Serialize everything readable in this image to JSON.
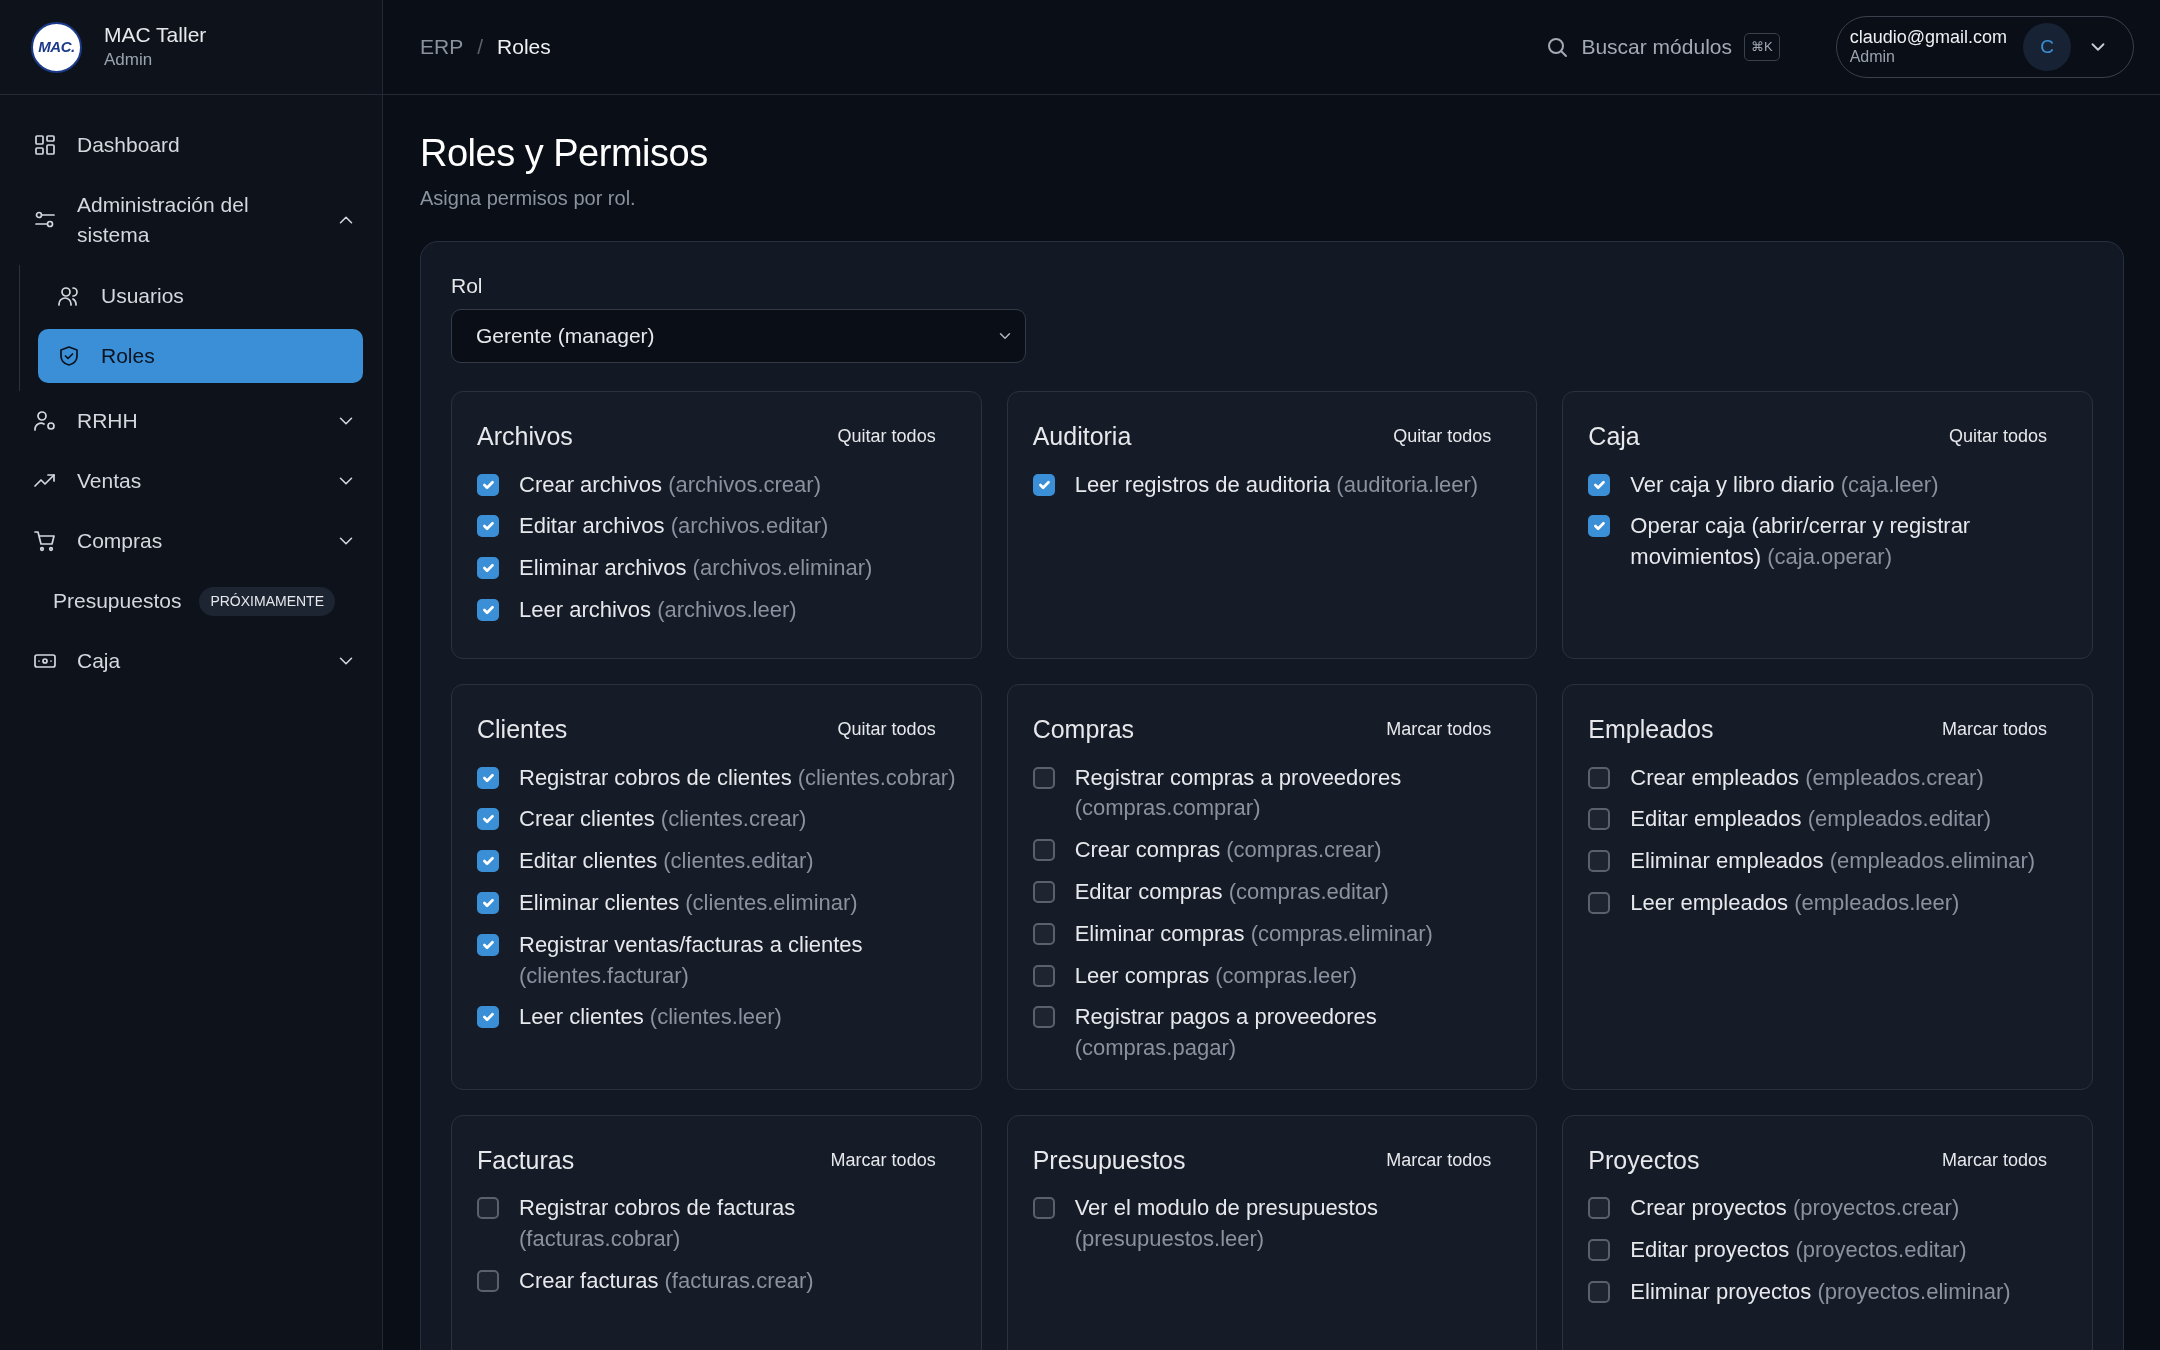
{
  "brand": {
    "logo_text": "MAC.",
    "name": "MAC Taller",
    "role": "Admin"
  },
  "sidebar": {
    "items": [
      {
        "label": "Dashboard",
        "kind": "link",
        "selected": false
      },
      {
        "label": "Administración del sistema",
        "kind": "group",
        "selected": false,
        "expanded": true,
        "children": [
          {
            "label": "Usuarios",
            "selected": false
          },
          {
            "label": "Roles",
            "selected": true
          }
        ]
      },
      {
        "label": "RRHH",
        "kind": "group",
        "selected": false,
        "expanded": false
      },
      {
        "label": "Ventas",
        "kind": "group",
        "selected": false,
        "expanded": false
      },
      {
        "label": "Compras",
        "kind": "group",
        "selected": false,
        "expanded": false
      },
      {
        "label": "Presupuestos",
        "kind": "soon",
        "selected": false,
        "badge": "PRÓXIMAMENTE"
      },
      {
        "label": "Caja",
        "kind": "group",
        "selected": false,
        "expanded": false
      }
    ]
  },
  "breadcrumb": [
    "ERP",
    "Roles"
  ],
  "breadcrumb_separator": "/",
  "search": {
    "placeholder": "Buscar módulos",
    "shortcut": "⌘K"
  },
  "user": {
    "email": "claudio@gmail.com",
    "role": "Admin",
    "initial": "C"
  },
  "page": {
    "title": "Roles y Permisos",
    "subtitle": "Asigna permisos por rol."
  },
  "role_select": {
    "label": "Rol",
    "value": "Gerente (manager)"
  },
  "modules": [
    {
      "title": "Archivos",
      "action": "Quitar todos",
      "permissions": [
        {
          "label": "Crear archivos",
          "code": "(archivos.crear)",
          "checked": true
        },
        {
          "label": "Editar archivos",
          "code": "(archivos.editar)",
          "checked": true
        },
        {
          "label": "Eliminar archivos",
          "code": "(archivos.eliminar)",
          "checked": true
        },
        {
          "label": "Leer archivos",
          "code": "(archivos.leer)",
          "checked": true
        }
      ]
    },
    {
      "title": "Auditoria",
      "action": "Quitar todos",
      "permissions": [
        {
          "label": "Leer registros de auditoria",
          "code": "(auditoria.leer)",
          "checked": true
        }
      ]
    },
    {
      "title": "Caja",
      "action": "Quitar todos",
      "permissions": [
        {
          "label": "Ver caja y libro diario",
          "code": "(caja.leer)",
          "checked": true
        },
        {
          "label": "Operar caja (abrir/cerrar y registrar movimientos)",
          "code": "(caja.operar)",
          "checked": true
        }
      ]
    },
    {
      "title": "Clientes",
      "action": "Quitar todos",
      "permissions": [
        {
          "label": "Registrar cobros de clientes",
          "code": "(clientes.cobrar)",
          "checked": true
        },
        {
          "label": "Crear clientes",
          "code": "(clientes.crear)",
          "checked": true
        },
        {
          "label": "Editar clientes",
          "code": "(clientes.editar)",
          "checked": true
        },
        {
          "label": "Eliminar clientes",
          "code": "(clientes.eliminar)",
          "checked": true
        },
        {
          "label": "Registrar ventas/facturas a clientes",
          "code": "(clientes.facturar)",
          "checked": true
        },
        {
          "label": "Leer clientes",
          "code": "(clientes.leer)",
          "checked": true
        }
      ]
    },
    {
      "title": "Compras",
      "action": "Marcar todos",
      "permissions": [
        {
          "label": "Registrar compras a proveedores",
          "code": "(compras.comprar)",
          "checked": false
        },
        {
          "label": "Crear compras",
          "code": "(compras.crear)",
          "checked": false
        },
        {
          "label": "Editar compras",
          "code": "(compras.editar)",
          "checked": false
        },
        {
          "label": "Eliminar compras",
          "code": "(compras.eliminar)",
          "checked": false
        },
        {
          "label": "Leer compras",
          "code": "(compras.leer)",
          "checked": false
        },
        {
          "label": "Registrar pagos a proveedores",
          "code": "(compras.pagar)",
          "checked": false
        }
      ]
    },
    {
      "title": "Empleados",
      "action": "Marcar todos",
      "permissions": [
        {
          "label": "Crear empleados",
          "code": "(empleados.crear)",
          "checked": false
        },
        {
          "label": "Editar empleados",
          "code": "(empleados.editar)",
          "checked": false
        },
        {
          "label": "Eliminar empleados",
          "code": "(empleados.eliminar)",
          "checked": false
        },
        {
          "label": "Leer empleados",
          "code": "(empleados.leer)",
          "checked": false
        }
      ]
    },
    {
      "title": "Facturas",
      "action": "Marcar todos",
      "permissions": [
        {
          "label": "Registrar cobros de facturas",
          "code": "(facturas.cobrar)",
          "checked": false
        },
        {
          "label": "Crear facturas",
          "code": "(facturas.crear)",
          "checked": false
        }
      ]
    },
    {
      "title": "Presupuestos",
      "action": "Marcar todos",
      "permissions": [
        {
          "label": "Ver el modulo de presupuestos",
          "code": "(presupuestos.leer)",
          "checked": false
        }
      ]
    },
    {
      "title": "Proyectos",
      "action": "Marcar todos",
      "permissions": [
        {
          "label": "Crear proyectos",
          "code": "(proyectos.crear)",
          "checked": false
        },
        {
          "label": "Editar proyectos",
          "code": "(proyectos.editar)",
          "checked": false
        },
        {
          "label": "Eliminar proyectos",
          "code": "(proyectos.eliminar)",
          "checked": false
        }
      ]
    }
  ]
}
